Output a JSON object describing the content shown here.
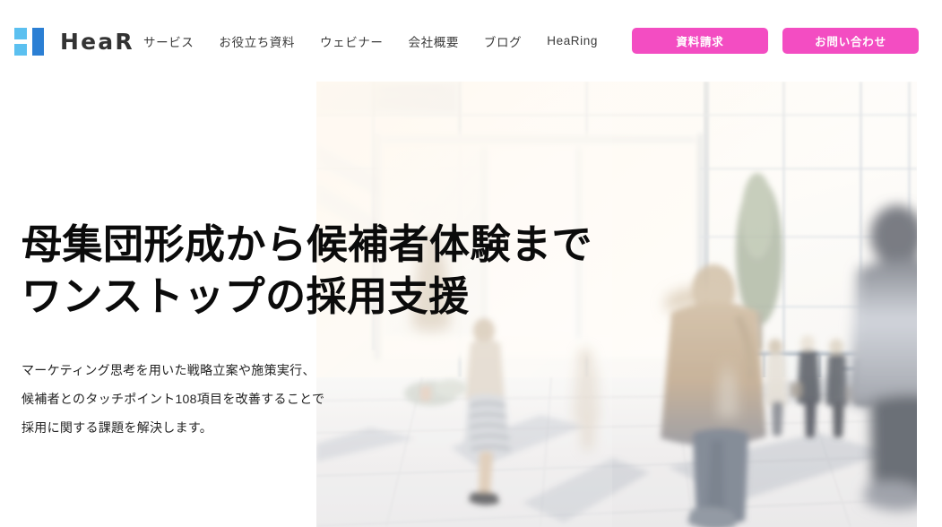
{
  "header": {
    "logo": {
      "text": "HeaR",
      "mark_light_color": "#5bc0f0",
      "mark_dark_color": "#2b7fd4"
    },
    "nav": [
      {
        "label": "サービス"
      },
      {
        "label": "お役立ち資料"
      },
      {
        "label": "ウェビナー"
      },
      {
        "label": "会社概要"
      },
      {
        "label": "ブログ"
      },
      {
        "label": "HeaRing"
      }
    ],
    "ctas": [
      {
        "label": "資料請求",
        "color": "#f34dc2"
      },
      {
        "label": "お問い合わせ",
        "color": "#f34dc2"
      }
    ]
  },
  "hero": {
    "title_lines": [
      "母集団形成から候補者体験まで",
      "ワンストップの採用支援"
    ],
    "lead_lines": [
      "マーケティング思考を用いた戦略立案や施策実行、",
      "候補者とのタッチポイント108項目を改善することで",
      "採用に関する課題を解決します。"
    ],
    "image_alt": "明るいオフィスロビーを歩くビジネスパーソン（モーションブラー）"
  }
}
